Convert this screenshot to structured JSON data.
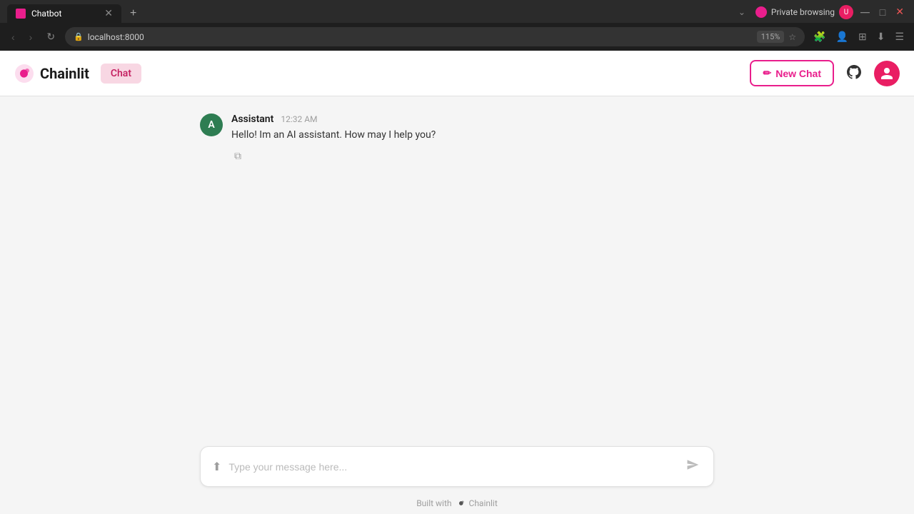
{
  "browser": {
    "tab": {
      "title": "Chatbot",
      "favicon_color": "#e91e8c"
    },
    "address": "localhost:8000",
    "zoom": "115%",
    "private_label": "Private browsing"
  },
  "header": {
    "logo_text": "Chainlit",
    "chat_badge_label": "Chat",
    "new_chat_label": "New Chat",
    "new_chat_icon": "✏",
    "github_icon": "⊕",
    "user_icon": "👤"
  },
  "chat": {
    "messages": [
      {
        "id": 1,
        "author_initial": "A",
        "author_name": "Assistant",
        "timestamp": "12:32 AM",
        "text": "Hello! Im an AI assistant. How may I help you?",
        "avatar_color": "#2e7d52"
      }
    ]
  },
  "input": {
    "placeholder": "Type your message here...",
    "expand_icon": "⬆",
    "send_icon": "➤"
  },
  "footer": {
    "built_with": "Built with",
    "brand": "Chainlit"
  }
}
